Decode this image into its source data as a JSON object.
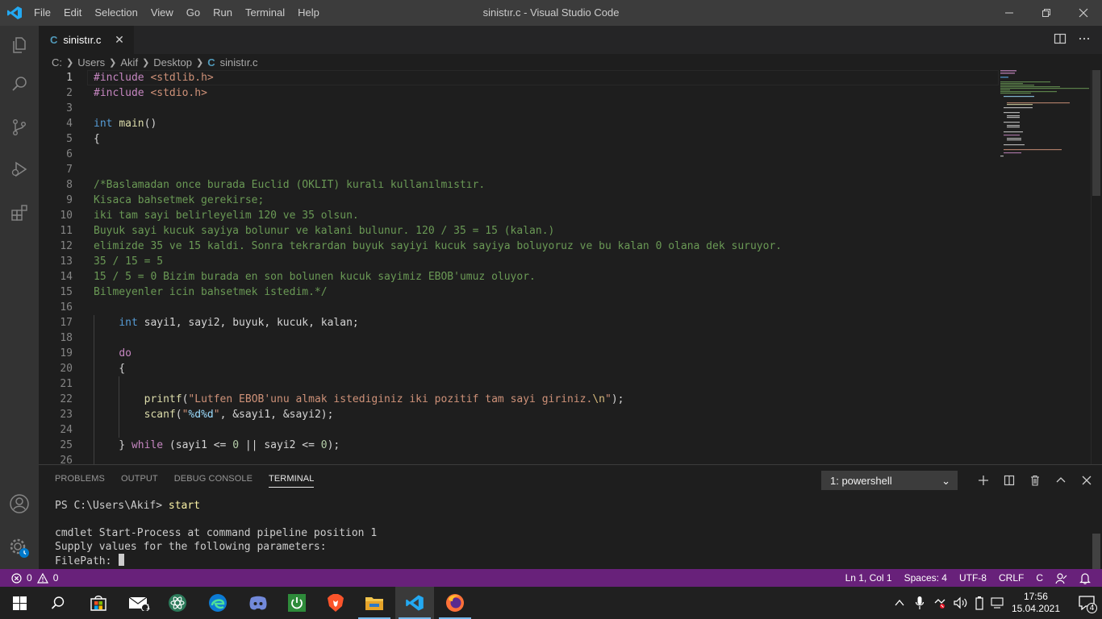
{
  "window": {
    "title": "sinistır.c - Visual Studio Code",
    "menu": [
      "File",
      "Edit",
      "Selection",
      "View",
      "Go",
      "Run",
      "Terminal",
      "Help"
    ]
  },
  "tab": {
    "label": "sinistır.c",
    "lang_badge": "C",
    "close": "✕"
  },
  "breadcrumb": {
    "parts": [
      "C:",
      "Users",
      "Akif",
      "Desktop"
    ],
    "file": "sinistır.c",
    "lang_badge": "C"
  },
  "editor": {
    "lines": [
      {
        "n": "1",
        "text": "#include <stdlib.h>"
      },
      {
        "n": "2",
        "text": "#include <stdio.h>"
      },
      {
        "n": "3",
        "text": ""
      },
      {
        "n": "4",
        "text": "int main()"
      },
      {
        "n": "5",
        "text": "{"
      },
      {
        "n": "6",
        "text": ""
      },
      {
        "n": "7",
        "text": ""
      },
      {
        "n": "8",
        "text": "/*Baslamadan once burada Euclid (OKLIT) kuralı kullanılmıstır."
      },
      {
        "n": "9",
        "text": "Kisaca bahsetmek gerekirse;"
      },
      {
        "n": "10",
        "text": "iki tam sayi belirleyelim 120 ve 35 olsun."
      },
      {
        "n": "11",
        "text": "Buyuk sayi kucuk sayiya bolunur ve kalani bulunur. 120 / 35 = 15 (kalan.)"
      },
      {
        "n": "12",
        "text": "elimizde 35 ve 15 kaldi. Sonra tekrardan buyuk sayiyi kucuk sayiya boluyoruz ve bu kalan 0 olana dek suruyor."
      },
      {
        "n": "13",
        "text": "35 / 15 = 5"
      },
      {
        "n": "14",
        "text": "15 / 5 = 0 Bizim burada en son bolunen kucuk sayimiz EBOB'umuz oluyor."
      },
      {
        "n": "15",
        "text": "Bilmeyenler icin bahsetmek istedim.*/"
      },
      {
        "n": "16",
        "text": ""
      },
      {
        "n": "17",
        "text": "    int sayi1, sayi2, buyuk, kucuk, kalan;"
      },
      {
        "n": "18",
        "text": ""
      },
      {
        "n": "19",
        "text": "    do"
      },
      {
        "n": "20",
        "text": "    {"
      },
      {
        "n": "21",
        "text": ""
      },
      {
        "n": "22",
        "text": "        printf(\"Lutfen EBOB'unu almak istediginiz iki pozitif tam sayi giriniz.\\n\");"
      },
      {
        "n": "23",
        "text": "        scanf(\"%d%d\", &sayi1, &sayi2);"
      },
      {
        "n": "24",
        "text": ""
      },
      {
        "n": "25",
        "text": "    } while (sayi1 <= 0 || sayi2 <= 0);"
      },
      {
        "n": "26",
        "text": ""
      }
    ]
  },
  "panel": {
    "tabs": [
      "PROBLEMS",
      "OUTPUT",
      "DEBUG CONSOLE",
      "TERMINAL"
    ],
    "active_tab": "TERMINAL",
    "terminal_select": "1: powershell",
    "terminal": {
      "prompt": "PS C:\\Users\\Akif> ",
      "command": "start",
      "line2": "cmdlet Start-Process at command pipeline position 1",
      "line3": "Supply values for the following parameters:",
      "line4": "FilePath: "
    }
  },
  "status": {
    "errors": "0",
    "warnings": "0",
    "position": "Ln 1, Col 1",
    "spaces": "Spaces: 4",
    "encoding": "UTF-8",
    "eol": "CRLF",
    "language": "C",
    "color": "#68217a"
  },
  "taskbar": {
    "time": "17:56",
    "date": "15.04.2021",
    "mail_badge": "1",
    "notif_badge": "4"
  }
}
